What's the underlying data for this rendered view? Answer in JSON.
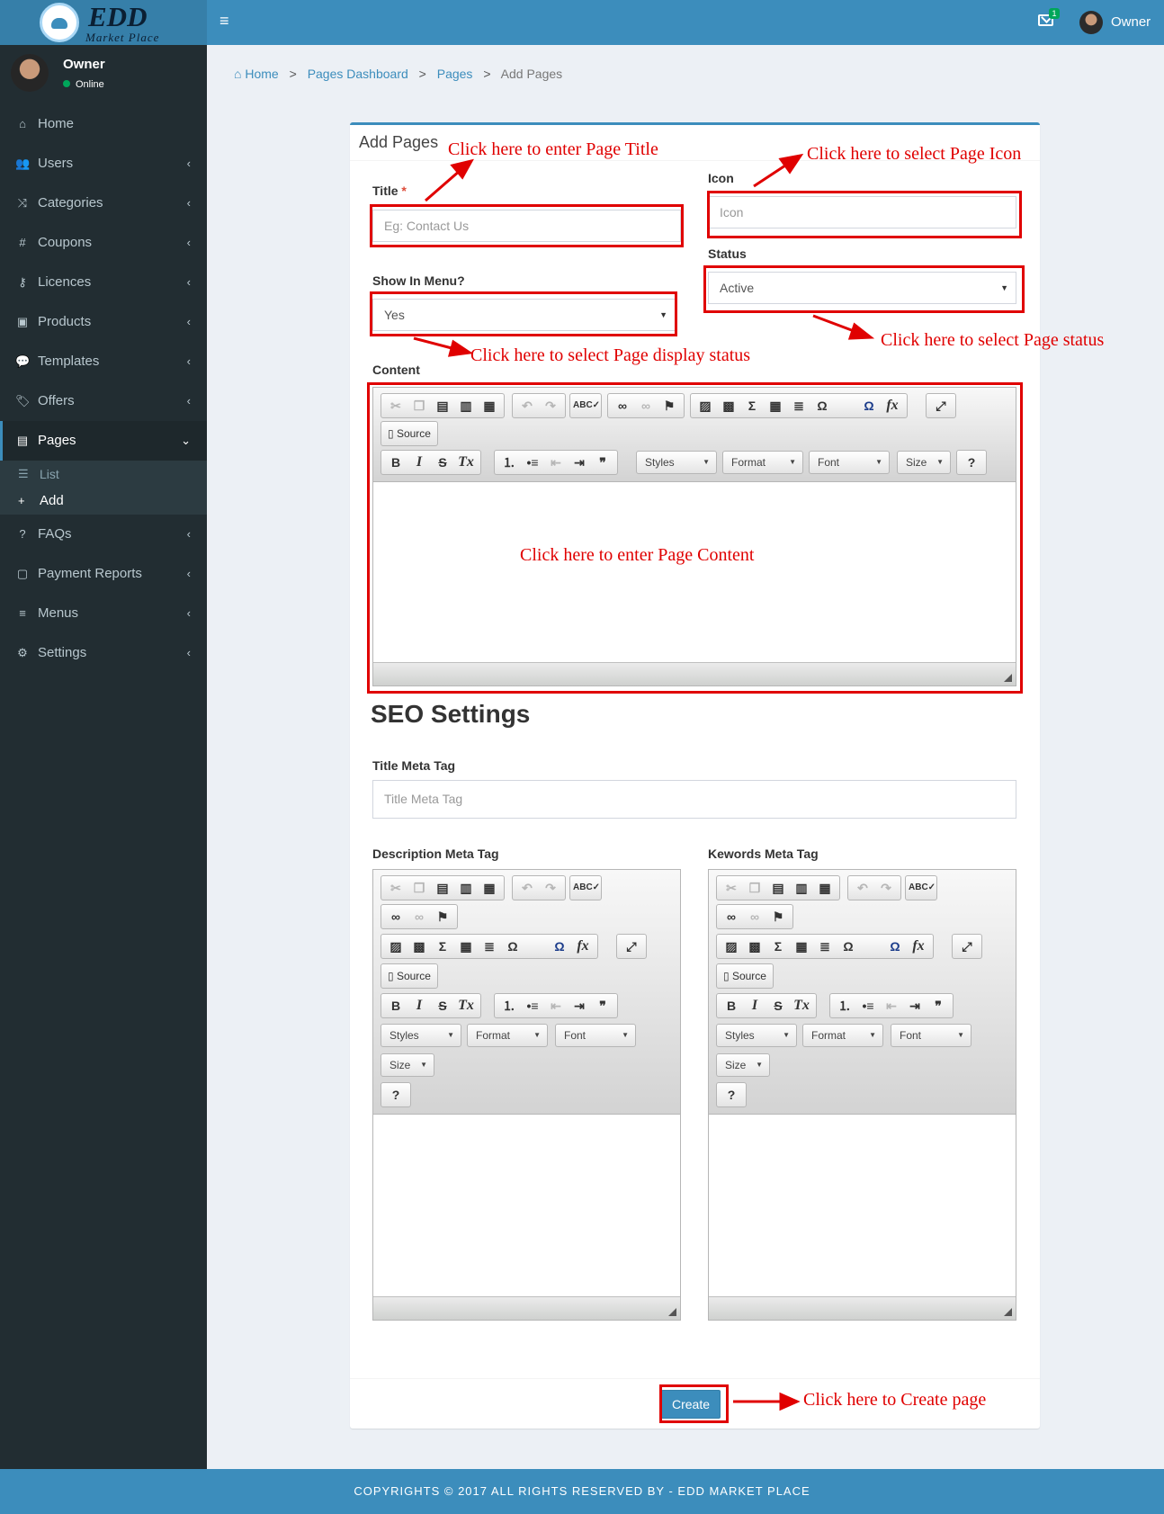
{
  "brand": {
    "name": "EDD",
    "subtitle": "Market Place"
  },
  "header": {
    "mail_count": "1",
    "user": "Owner"
  },
  "user_panel": {
    "name": "Owner",
    "status": "Online"
  },
  "menu": [
    {
      "label": "Home",
      "icon": "home-icon",
      "glyph": "⌂"
    },
    {
      "label": "Users",
      "icon": "users-icon",
      "glyph": "👥"
    },
    {
      "label": "Categories",
      "icon": "random-icon",
      "glyph": "⤨"
    },
    {
      "label": "Coupons",
      "icon": "hashtag-icon",
      "glyph": "#"
    },
    {
      "label": "Licences",
      "icon": "key-icon",
      "glyph": "⚷"
    },
    {
      "label": "Products",
      "icon": "shopping-bag-icon",
      "glyph": "▣"
    },
    {
      "label": "Templates",
      "icon": "comment-icon",
      "glyph": "💬"
    },
    {
      "label": "Offers",
      "icon": "tags-icon",
      "glyph": "🏷"
    },
    {
      "label": "Pages",
      "icon": "file-icon",
      "glyph": "▤"
    },
    {
      "label": "FAQs",
      "icon": "question-icon",
      "glyph": "?"
    },
    {
      "label": "Payment Reports",
      "icon": "file-icon",
      "glyph": "▢"
    },
    {
      "label": "Menus",
      "icon": "bars-icon",
      "glyph": "≡"
    },
    {
      "label": "Settings",
      "icon": "gear-icon",
      "glyph": "⚙"
    }
  ],
  "pages_submenu": [
    {
      "label": "List",
      "icon": "list-icon",
      "glyph": "☰"
    },
    {
      "label": "Add",
      "icon": "plus-icon",
      "glyph": "+"
    }
  ],
  "breadcrumb": {
    "home": "Home",
    "dashboard": "Pages Dashboard",
    "pages": "Pages",
    "current": "Add Pages",
    "separator": ">"
  },
  "form": {
    "box_title": "Add Pages",
    "title_label": "Title",
    "title_required": "*",
    "title_placeholder": "Eg: Contact Us",
    "icon_label": "Icon",
    "icon_placeholder": "Icon",
    "show_in_menu_label": "Show In Menu?",
    "show_in_menu_value": "Yes",
    "status_label": "Status",
    "status_value": "Active",
    "content_label": "Content",
    "seo_heading": "SEO Settings",
    "title_meta_label": "Title Meta Tag",
    "title_meta_placeholder": "Title Meta Tag",
    "description_meta_label": "Description Meta Tag",
    "keywords_meta_label": "Kewords Meta Tag",
    "create_button": "Create"
  },
  "editor": {
    "source_label": "Source",
    "styles_label": "Styles",
    "format_label": "Format",
    "font_label": "Font",
    "size_label": "Size",
    "help_label": "?"
  },
  "annotations": {
    "title": "Click here to enter Page Title",
    "icon": "Click here to select Page Icon",
    "status": "Click here to select Page status",
    "display": "Click here to select Page display status",
    "content": "Click here to enter Page Content",
    "create": "Click here to Create page"
  },
  "footer": {
    "text": "COPYRIGHTS © 2017 ALL RIGHTS RESERVED BY - EDD MARKET PLACE"
  },
  "colors": {
    "header": "#3c8dbc",
    "sidebar": "#222d32",
    "annotation": "#e00000",
    "button": "#3c8dbc"
  }
}
